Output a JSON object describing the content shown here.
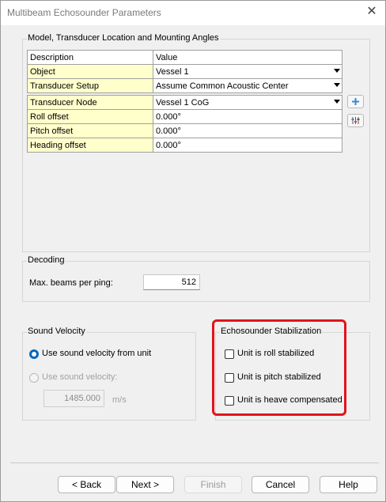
{
  "window": {
    "title": "Multibeam Echosounder Parameters",
    "close": "✕"
  },
  "model_group": {
    "title": "Model, Transducer Location and Mounting Angles",
    "headers": {
      "description": "Description",
      "value": "Value"
    },
    "rows": [
      {
        "description": "Object",
        "value": "Vessel 1"
      },
      {
        "description": "Transducer Setup",
        "value": "Assume Common Acoustic Center"
      },
      {
        "description": "Transducer Node",
        "value": "Vessel 1 CoG"
      },
      {
        "description": "Roll offset",
        "value": "0.000°"
      },
      {
        "description": "Pitch offset",
        "value": "0.000°"
      },
      {
        "description": "Heading offset",
        "value": "0.000°"
      }
    ]
  },
  "decoding": {
    "title": "Decoding",
    "max_beams_label": "Max.  beams per ping:",
    "max_beams_value": "512"
  },
  "sound_velocity": {
    "title": "Sound Velocity",
    "option_unit": "Use sound velocity from unit",
    "option_manual": "Use sound velocity:",
    "velocity_value": "1485.000",
    "velocity_unit": "m/s"
  },
  "stabilization": {
    "title": "Echosounder Stabilization",
    "roll": "Unit is roll stabilized",
    "pitch": "Unit is pitch stabilized",
    "heave": "Unit is heave compensated"
  },
  "buttons": {
    "back": "< Back",
    "next": "Next >",
    "finish": "Finish",
    "cancel": "Cancel",
    "help": "Help"
  },
  "colors": {
    "accent": "#0067c0",
    "highlight": "#e0141c",
    "description_cell": "#ffffcc"
  }
}
